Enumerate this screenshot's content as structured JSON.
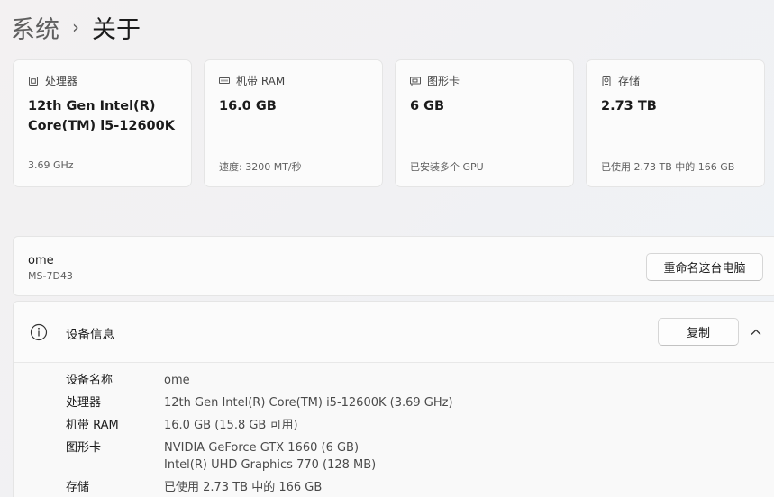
{
  "breadcrumb": {
    "parent": "系统",
    "separator": "›",
    "current": "关于"
  },
  "cards": [
    {
      "label": "处理器",
      "icon": "processor-icon",
      "value": "12th Gen Intel(R) Core(TM) i5-12600K",
      "sub": "3.69 GHz"
    },
    {
      "label": "机带 RAM",
      "icon": "ram-icon",
      "value": "16.0 GB",
      "sub": "速度: 3200 MT/秒"
    },
    {
      "label": "图形卡",
      "icon": "graphics-card-icon",
      "value": "6 GB",
      "sub": "已安装多个 GPU"
    },
    {
      "label": "存储",
      "icon": "storage-icon",
      "value": "2.73 TB",
      "sub": "已使用 2.73 TB 中的 166 GB"
    }
  ],
  "device": {
    "name": "ome",
    "model": "MS-7D43",
    "rename_label": "重命名这台电脑"
  },
  "device_info": {
    "title": "设备信息",
    "copy_label": "复制",
    "rows": [
      {
        "label": "设备名称",
        "value": "ome"
      },
      {
        "label": "处理器",
        "value": "12th Gen Intel(R) Core(TM) i5-12600K (3.69 GHz)"
      },
      {
        "label": "机带 RAM",
        "value": "16.0 GB (15.8 GB 可用)"
      },
      {
        "label": "图形卡",
        "value": "NVIDIA GeForce GTX 1660 (6 GB)",
        "value2": "Intel(R) UHD Graphics 770 (128 MB)"
      },
      {
        "label": "存储",
        "value": "已使用 2.73 TB 中的 166 GB"
      }
    ]
  }
}
